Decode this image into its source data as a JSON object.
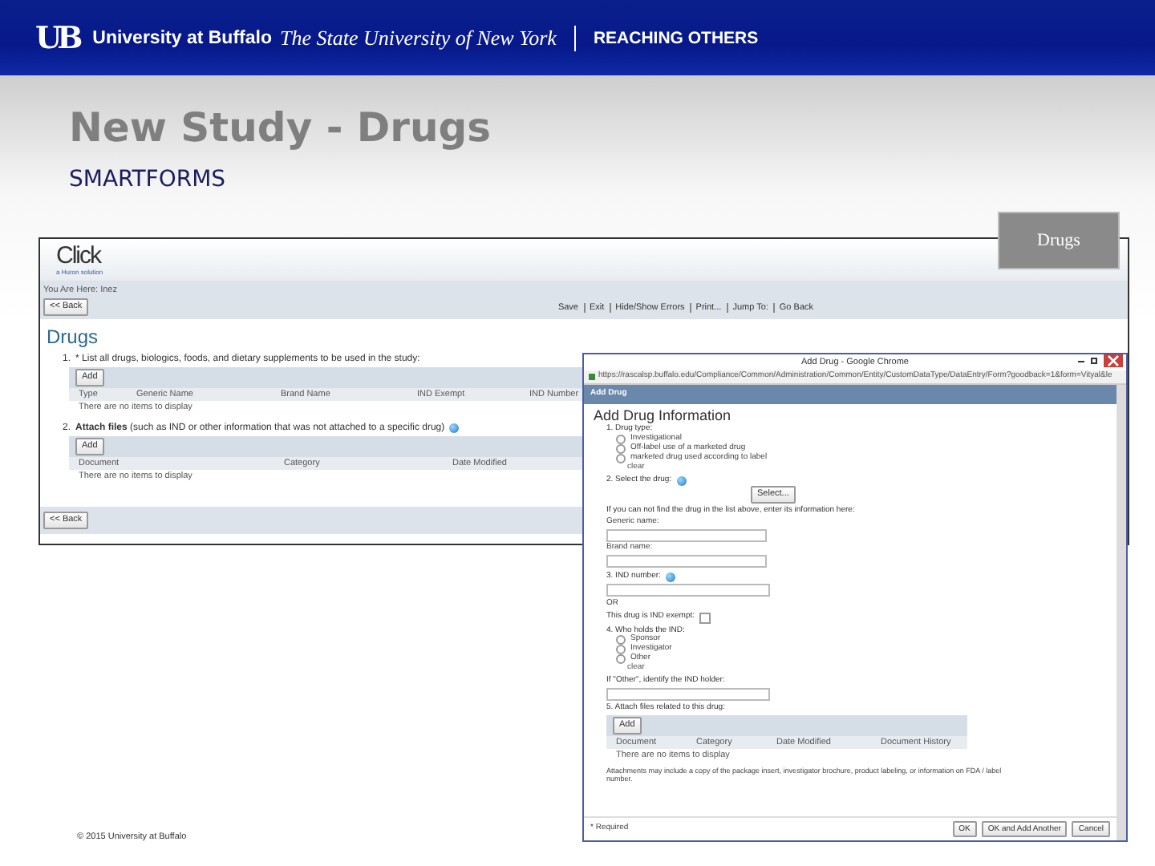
{
  "header": {
    "logo": "UB",
    "university": "University at Buffalo",
    "tagline": "The State University of New York",
    "motto": "REACHING OTHERS"
  },
  "title": "New Study - Drugs",
  "subtitle": "SMARTFORMS",
  "section_tab": "Drugs",
  "main_screen": {
    "logo": "Click",
    "logo_sub": "a Huron solution",
    "breadcrumb": "You Are Here: Inez",
    "back_button": "<< Back",
    "toolbar": [
      "Save",
      "Exit",
      "Hide/Show Errors",
      "Print...",
      "Jump To:",
      "Go Back"
    ],
    "heading": "Drugs",
    "questions": [
      {
        "number": "1.",
        "text": "* List all drugs, biologics, foods, and dietary supplements to be used in the study:",
        "help": false,
        "button": "Add",
        "columns": [
          "Type",
          "Generic Name",
          "Brand Name",
          "IND Exempt",
          "IND Number"
        ],
        "empty": "There are no items to display"
      },
      {
        "number": "2.",
        "text": "**Attach files** (such as IND or other information that was not attached to a specific drug)",
        "help": true,
        "button": "Add",
        "columns": [
          "Document",
          "Category",
          "Date Modified"
        ],
        "empty": "There are no items to display"
      }
    ],
    "bottom_button": "<< Back"
  },
  "popup": {
    "title": "Add Drug - Google Chrome",
    "url": "https://rascalsp.buffalo.edu/Compliance/Common/Administration/Common/Entity/CustomDataType/DataEntry/Form?goodback=1&form=Vityal&le",
    "form_title": "Add Drug",
    "heading": "Add Drug Information",
    "items": [
      {
        "kind": "radio",
        "label": "1. Drug type:",
        "options": [
          {
            "label": "Investigational",
            "selected": false
          },
          {
            "label": "Off-label use of a marketed drug",
            "selected": false
          },
          {
            "label": "marketed drug used according to label",
            "selected": false
          }
        ],
        "clear": "clear"
      },
      {
        "kind": "select",
        "label": "2. Select the drug:",
        "help": true,
        "button": "Select..."
      },
      {
        "kind": "fields",
        "label": "If you can not find the drug in the list above, enter its information here:",
        "fields": [
          "Generic name:",
          "Brand name:"
        ]
      },
      {
        "kind": "text",
        "label": "3. IND number:",
        "help": true,
        "after": "OR"
      },
      {
        "kind": "check",
        "label": "This drug is IND exempt:",
        "checked": false
      },
      {
        "kind": "radio",
        "label": "4. Who holds the IND:",
        "options": [
          {
            "label": "Sponsor",
            "selected": false
          },
          {
            "label": "Investigator",
            "selected": false
          },
          {
            "label": "Other",
            "selected": false
          }
        ],
        "clear": "clear"
      },
      {
        "kind": "text",
        "label": "If \"Other\", identify the IND holder:",
        "help": false
      },
      {
        "kind": "table",
        "label": "5. Attach files related to this drug:",
        "button": "Add",
        "columns": [
          "Document",
          "Category",
          "Date Modified",
          "Document History"
        ],
        "empty": "There are no items to display",
        "note": "Attachments may include a copy of the package insert, investigator brochure, product labeling, or information on FDA / label number."
      }
    ],
    "required": "* Required",
    "buttons": [
      "OK",
      "OK and Add Another",
      "Cancel"
    ]
  },
  "footer": "© 2015 University at Buffalo"
}
